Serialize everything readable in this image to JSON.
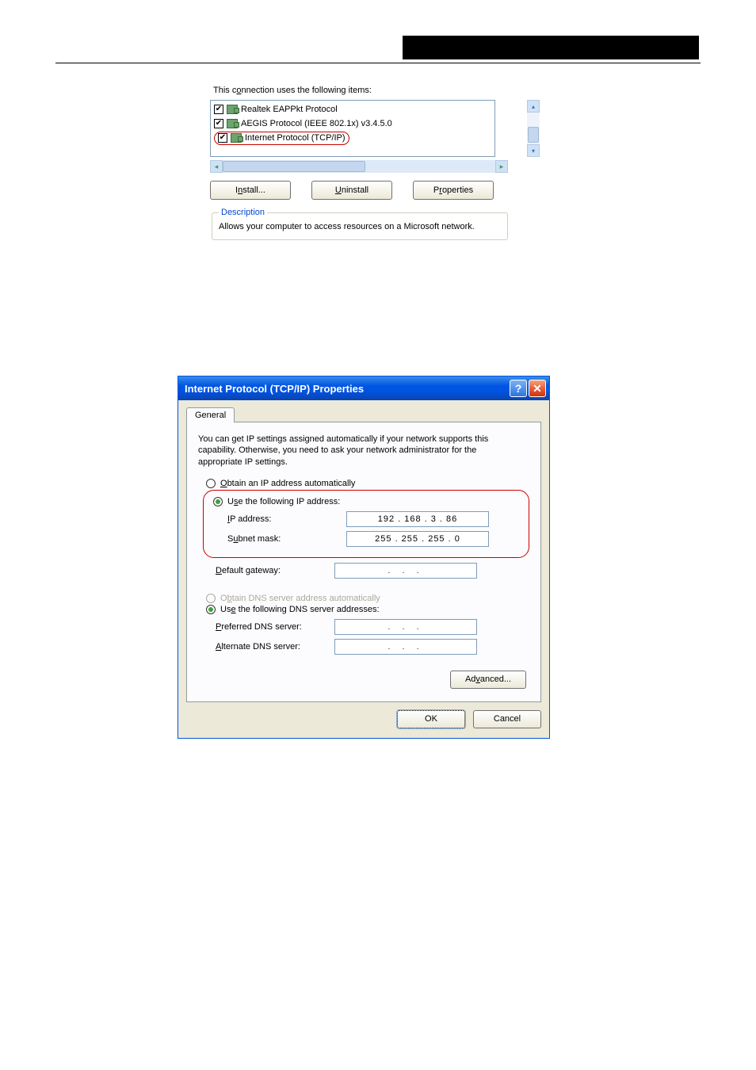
{
  "upper": {
    "label": "This connection uses the following items:",
    "items": [
      {
        "checked": true,
        "text": "Realtek EAPPkt Protocol",
        "circled": false
      },
      {
        "checked": true,
        "text": "AEGIS Protocol (IEEE 802.1x) v3.4.5.0",
        "circled": false
      },
      {
        "checked": true,
        "text": "Internet Protocol (TCP/IP)",
        "circled": true
      }
    ],
    "buttons": {
      "install": "Install...",
      "uninstall": "Uninstall",
      "properties": "Properties"
    },
    "desc_legend": "Description",
    "desc_text": "Allows your computer to access resources on a Microsoft network."
  },
  "dialog": {
    "title": "Internet Protocol (TCP/IP) Properties",
    "tab": "General",
    "help": "You can get IP settings assigned automatically if your network supports this capability. Otherwise, you need to ask your network administrator for the appropriate IP settings.",
    "radio_obtain_ip": "Obtain an IP address automatically",
    "radio_use_ip": "Use the following IP address:",
    "ip_label": "IP address:",
    "ip_value": "192 . 168 .   3  .  86",
    "subnet_label": "Subnet mask:",
    "subnet_value": "255 . 255 . 255 .   0",
    "gateway_label": "Default gateway:",
    "gateway_value": ".       .       .",
    "radio_obtain_dns": "Obtain DNS server address automatically",
    "radio_use_dns": "Use the following DNS server addresses:",
    "pref_dns_label": "Preferred DNS server:",
    "pref_dns_value": ".       .       .",
    "alt_dns_label": "Alternate DNS server:",
    "alt_dns_value": ".       .       .",
    "advanced": "Advanced...",
    "ok": "OK",
    "cancel": "Cancel"
  }
}
